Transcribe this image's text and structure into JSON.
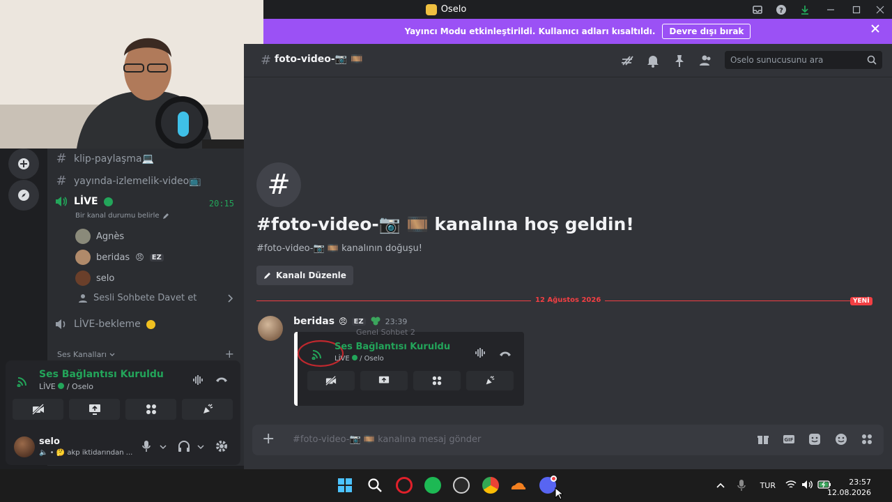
{
  "window": {
    "title": "Oselo"
  },
  "banner": {
    "message": "Yayıncı Modu etkinleştirildi. Kullanıcı adları kısaltıldı.",
    "button_label": "Devre dışı bırak"
  },
  "header": {
    "channel_title": "foto-video-📷 🎞️",
    "search_placeholder": "Oselo sunucusunu ara"
  },
  "sidebar": {
    "channels": [
      {
        "name": "klip-paylaşma💻"
      },
      {
        "name": "yayında-izlemelik-video📺"
      }
    ],
    "live_channel": {
      "name": "LİVE",
      "timer": "20:15",
      "status_hint": "Bir kanal durumu belirle"
    },
    "voice_users": [
      {
        "name": "Agnès"
      },
      {
        "name": "beridas",
        "tag": "EZ"
      },
      {
        "name": "selo"
      }
    ],
    "invite_label": "Sesli Sohbete Davet et",
    "waiting_channel": "LİVE-bekleme",
    "section_label": "Ses Kanalları"
  },
  "voice_panel": {
    "status": "Ses Bağlantısı Kuruldu",
    "location": "LİVE",
    "server": "/ Oselo"
  },
  "user": {
    "name": "selo",
    "status": "akp iktidarından ..."
  },
  "welcome": {
    "title": "#foto-video-📷 🎞️ kanalına hoş geldin!",
    "subtitle": "#foto-video-📷 🎞️ kanalının doğuşu!",
    "edit_label": "Kanalı Düzenle"
  },
  "divider": {
    "date": "12 Ağustos 2026",
    "new_label": "YENİ"
  },
  "message": {
    "author": "beridas",
    "tag": "EZ",
    "time": "23:39",
    "embed": {
      "peek_text": "Genel Sohbet 2",
      "status": "Ses Bağlantısı Kuruldu",
      "location": "LİVE",
      "server": "/ Oselo"
    }
  },
  "composer": {
    "placeholder": "#foto-video-📷 🎞️ kanalına mesaj gönder"
  },
  "taskbar": {
    "language": "TUR",
    "time": "23:57",
    "date": "12.08.2026"
  },
  "colors": {
    "accent": "#9b51f5",
    "connected": "#23a55a",
    "danger": "#f23f43"
  }
}
